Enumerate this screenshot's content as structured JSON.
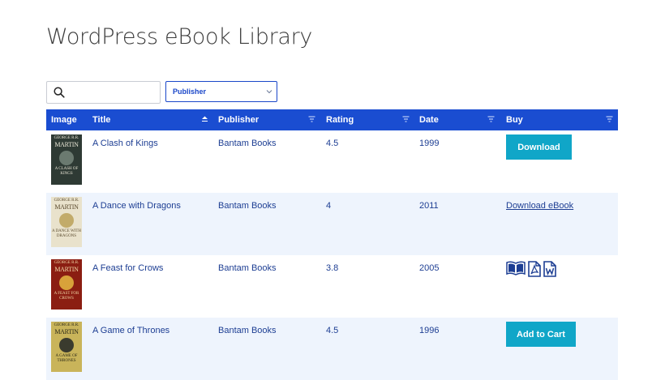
{
  "page": {
    "title": "WordPress eBook Library"
  },
  "search": {
    "placeholder": "",
    "value": "",
    "icon": "search-icon"
  },
  "filter": {
    "selected": "Publisher"
  },
  "table": {
    "columns": [
      {
        "label": "Image"
      },
      {
        "label": "Title"
      },
      {
        "label": "Publisher"
      },
      {
        "label": "Rating"
      },
      {
        "label": "Date"
      },
      {
        "label": "Buy"
      }
    ],
    "header_color": "#1a4dd1",
    "rows": [
      {
        "cover": {
          "author_top": "GEORGE R.R.",
          "author": "MARTIN",
          "sub": "A CLASH OF KINGS",
          "bg": "#2e3a34",
          "fg": "#e9e6d6"
        },
        "title": "A Clash of Kings",
        "publisher": "Bantam Books",
        "rating": "4.5",
        "date": "1999",
        "buy": {
          "type": "button",
          "label": "Download"
        }
      },
      {
        "cover": {
          "author_top": "GEORGE R.R.",
          "author": "MARTIN",
          "sub": "A DANCE WITH DRAGONS",
          "bg": "#e9e2cc",
          "fg": "#5a4a2e"
        },
        "title": "A Dance with Dragons",
        "publisher": "Bantam Books",
        "rating": "4",
        "date": "2011",
        "buy": {
          "type": "link",
          "label": "Download eBook"
        }
      },
      {
        "cover": {
          "author_top": "GEORGE R.R.",
          "author": "MARTIN",
          "sub": "A FEAST FOR CROWS",
          "bg": "#8b1e12",
          "fg": "#f1d9a8"
        },
        "title": "A Feast for Crows",
        "publisher": "Bantam Books",
        "rating": "3.8",
        "date": "2005",
        "buy": {
          "type": "icons",
          "icons": [
            "book-icon",
            "pdf-icon",
            "word-icon"
          ]
        }
      },
      {
        "cover": {
          "author_top": "GEORGE R.R.",
          "author": "MARTIN",
          "sub": "A GAME OF THRONES",
          "bg": "#c9b45a",
          "fg": "#2c2a18"
        },
        "title": "A Game of Thrones",
        "publisher": "Bantam Books",
        "rating": "4.5",
        "date": "1996",
        "buy": {
          "type": "button",
          "label": "Add to Cart"
        }
      }
    ]
  },
  "colors": {
    "accent": "#1a4dd1",
    "button": "#10a6c8",
    "row_alt": "#eef4fd",
    "text": "#1d3e93"
  }
}
